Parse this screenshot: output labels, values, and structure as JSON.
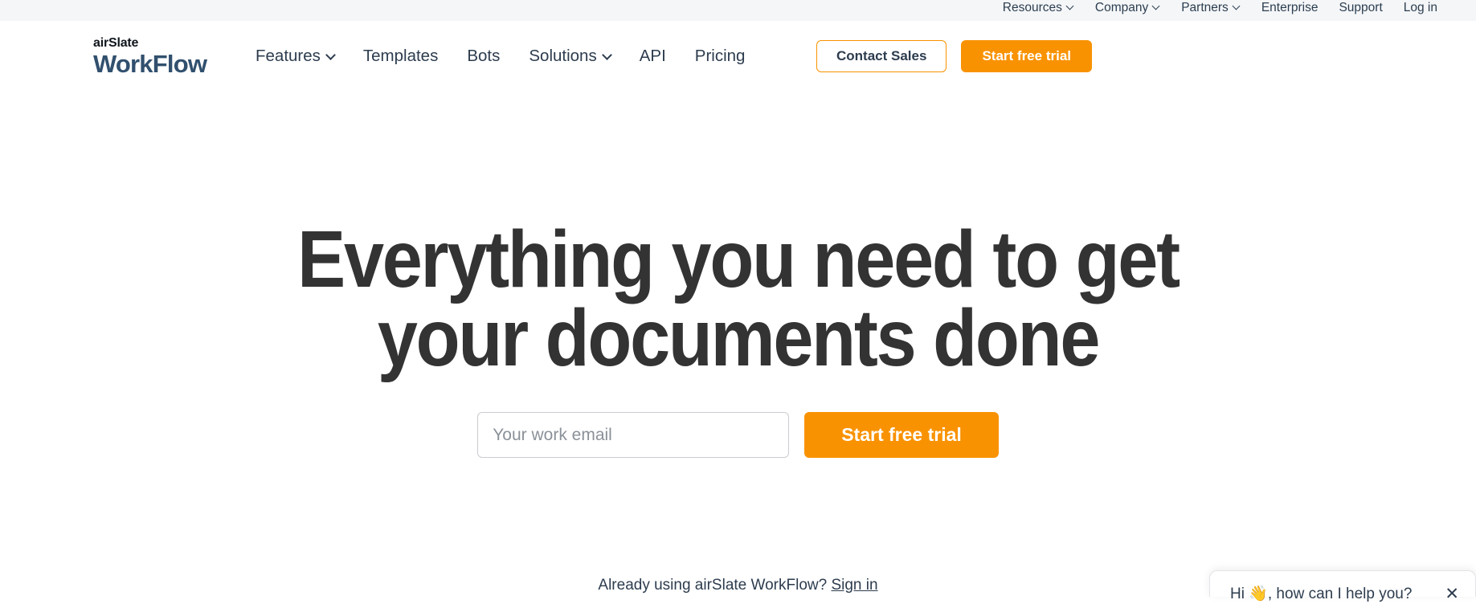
{
  "utility_nav": {
    "items": [
      {
        "label": "Resources",
        "has_dropdown": true
      },
      {
        "label": "Company",
        "has_dropdown": true
      },
      {
        "label": "Partners",
        "has_dropdown": true
      },
      {
        "label": "Enterprise",
        "has_dropdown": false
      },
      {
        "label": "Support",
        "has_dropdown": false
      },
      {
        "label": "Log in",
        "has_dropdown": false
      }
    ]
  },
  "logo": {
    "top_text": "airSlate",
    "bottom_text": "WorkFlow"
  },
  "main_nav": {
    "items": [
      {
        "label": "Features",
        "has_dropdown": true
      },
      {
        "label": "Templates",
        "has_dropdown": false
      },
      {
        "label": "Bots",
        "has_dropdown": false
      },
      {
        "label": "Solutions",
        "has_dropdown": true
      },
      {
        "label": "API",
        "has_dropdown": false
      },
      {
        "label": "Pricing",
        "has_dropdown": false
      }
    ]
  },
  "header_actions": {
    "contact_sales_label": "Contact Sales",
    "start_trial_label": "Start free trial"
  },
  "hero": {
    "title_line1": "Everything you need to get",
    "title_line2": "your documents done",
    "email_placeholder": "Your work email",
    "email_value": "",
    "cta_label": "Start free trial",
    "signin_prompt": "Already using airSlate WorkFlow?",
    "signin_link_label": "Sign in"
  },
  "chat_widget": {
    "message": "Hi 👋, how can I help you?",
    "close_label": "✕"
  },
  "colors": {
    "brand_orange": "#f99200",
    "logo_blue": "#31506e",
    "text_dark": "#2d3c4e",
    "heading": "#333333",
    "utility_bar_bg": "#f5f6f8"
  }
}
